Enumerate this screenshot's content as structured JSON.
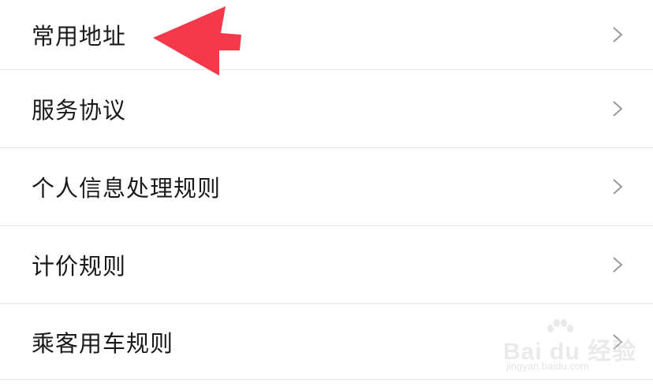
{
  "menu": {
    "items": [
      {
        "label": "常用地址"
      },
      {
        "label": "服务协议"
      },
      {
        "label": "个人信息处理规则"
      },
      {
        "label": "计价规则"
      },
      {
        "label": "乘客用车规则"
      }
    ],
    "chevron_icon": "chevron-right-icon",
    "divider_color": "#e6e6e6",
    "text_color": "#1a1a1a"
  },
  "annotation": {
    "icon": "red-pointer-arrow-icon",
    "color": "#f4394b"
  },
  "watermark": {
    "brand": "Bai du 经验",
    "url": "jingyan.baidu.com"
  }
}
